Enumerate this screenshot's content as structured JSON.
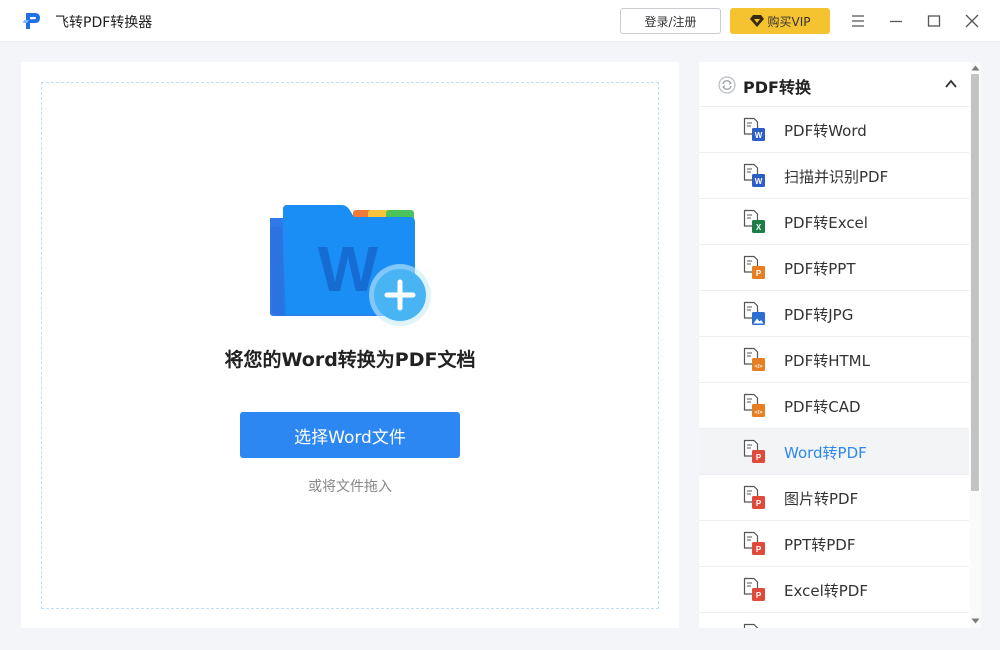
{
  "app": {
    "title": "飞转PDF转换器",
    "login_label": "登录/注册",
    "vip_label": "购买VIP"
  },
  "colors": {
    "accent": "#2d87f3",
    "vip": "#f5c330",
    "word_blue": "#2b5fc7",
    "excel_green": "#1e7d45",
    "ppt_orange": "#e67e22",
    "pdf_red": "#e04a3a"
  },
  "main": {
    "heading": "将您的Word转换为PDF文档",
    "choose_button": "选择Word文件",
    "drag_hint": "或将文件拖入",
    "folder_icon": "word-folder-add-icon"
  },
  "sidebar": {
    "section_title": "PDF转换",
    "section_icon": "refresh-icon",
    "items": [
      {
        "label": "PDF转Word",
        "icon": "pdf-to-word-icon",
        "badge": "W",
        "badge_color": "#2b5fc7",
        "active": false
      },
      {
        "label": "扫描并识别PDF",
        "icon": "scan-pdf-icon",
        "badge": "W",
        "badge_color": "#2b5fc7",
        "active": false
      },
      {
        "label": "PDF转Excel",
        "icon": "pdf-to-excel-icon",
        "badge": "X",
        "badge_color": "#1e7d45",
        "active": false
      },
      {
        "label": "PDF转PPT",
        "icon": "pdf-to-ppt-icon",
        "badge": "P",
        "badge_color": "#e67e22",
        "active": false
      },
      {
        "label": "PDF转JPG",
        "icon": "pdf-to-jpg-icon",
        "badge": "",
        "badge_color": "#2b6fd0",
        "active": false
      },
      {
        "label": "PDF转HTML",
        "icon": "pdf-to-html-icon",
        "badge": "</>",
        "badge_color": "#e67e22",
        "active": false
      },
      {
        "label": "PDF转CAD",
        "icon": "pdf-to-cad-icon",
        "badge": "</>",
        "badge_color": "#e67e22",
        "active": false
      },
      {
        "label": "Word转PDF",
        "icon": "word-to-pdf-icon",
        "badge": "P",
        "badge_color": "#e04a3a",
        "active": true
      },
      {
        "label": "图片转PDF",
        "icon": "image-to-pdf-icon",
        "badge": "P",
        "badge_color": "#e04a3a",
        "active": false
      },
      {
        "label": "PPT转PDF",
        "icon": "ppt-to-pdf-icon",
        "badge": "P",
        "badge_color": "#e04a3a",
        "active": false
      },
      {
        "label": "Excel转PDF",
        "icon": "excel-to-pdf-icon",
        "badge": "P",
        "badge_color": "#e04a3a",
        "active": false
      },
      {
        "label": "",
        "icon": "more-convert-icon",
        "badge": "P",
        "badge_color": "#e04a3a",
        "active": false
      }
    ]
  }
}
